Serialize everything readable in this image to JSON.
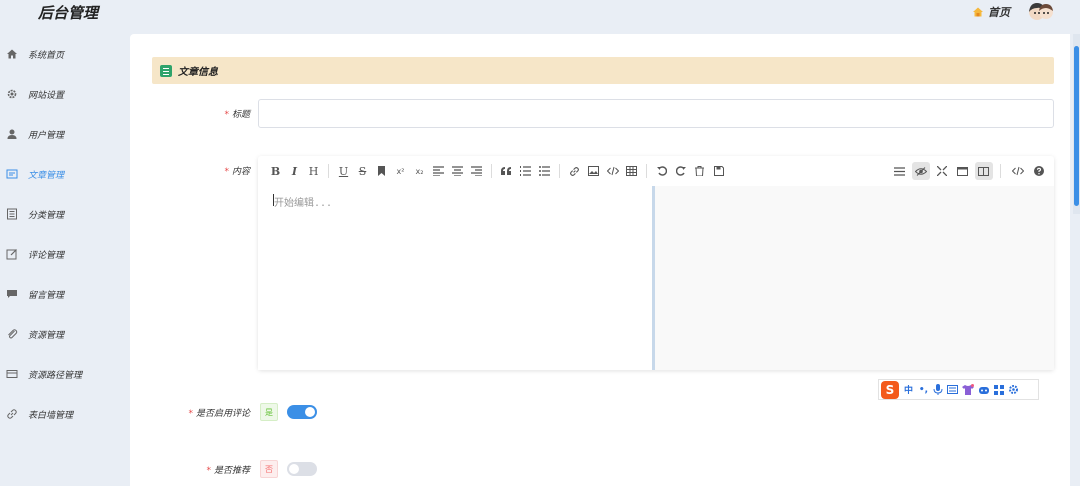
{
  "header": {
    "app_title": "后台管理",
    "home_label": "首页",
    "home_icon": "home-icon",
    "avatar_icon": "user-avatar"
  },
  "sidebar": {
    "items": [
      {
        "label": "系统首页",
        "icon": "home-icon",
        "active": false
      },
      {
        "label": "网站设置",
        "icon": "gear-icon",
        "active": false
      },
      {
        "label": "用户管理",
        "icon": "user-icon",
        "active": false
      },
      {
        "label": "文章管理",
        "icon": "article-icon",
        "active": true
      },
      {
        "label": "分类管理",
        "icon": "category-icon",
        "active": false
      },
      {
        "label": "评论管理",
        "icon": "edit-icon",
        "active": false
      },
      {
        "label": "留言管理",
        "icon": "message-icon",
        "active": false
      },
      {
        "label": "资源管理",
        "icon": "paperclip-icon",
        "active": false
      },
      {
        "label": "资源路径管理",
        "icon": "card-icon",
        "active": false
      },
      {
        "label": "表白墙管理",
        "icon": "link-icon",
        "active": false
      }
    ]
  },
  "form": {
    "section_title": "文章信息",
    "required_mark": "*",
    "title_label": "标题",
    "title_value": "",
    "content_label": "内容",
    "editor_placeholder": "开始编辑...",
    "comment_label": "是否启用评论",
    "comment_tag": "是",
    "comment_enabled": true,
    "recommend_label": "是否推荐",
    "recommend_tag": "否",
    "recommend_enabled": false
  },
  "toolbar": {
    "bold": "B",
    "italic": "I",
    "heading": "H",
    "underline": "U",
    "strike": "S",
    "superscript": "x²",
    "subscript": "x₂"
  },
  "ime": {
    "logo": "S",
    "chinese": "中",
    "punct": "•,"
  },
  "colors": {
    "accent": "#3b8fe6",
    "section_header_bg": "#f6e6c8",
    "required": "#e54b4b",
    "sidebar_bg": "#e9eef5"
  }
}
